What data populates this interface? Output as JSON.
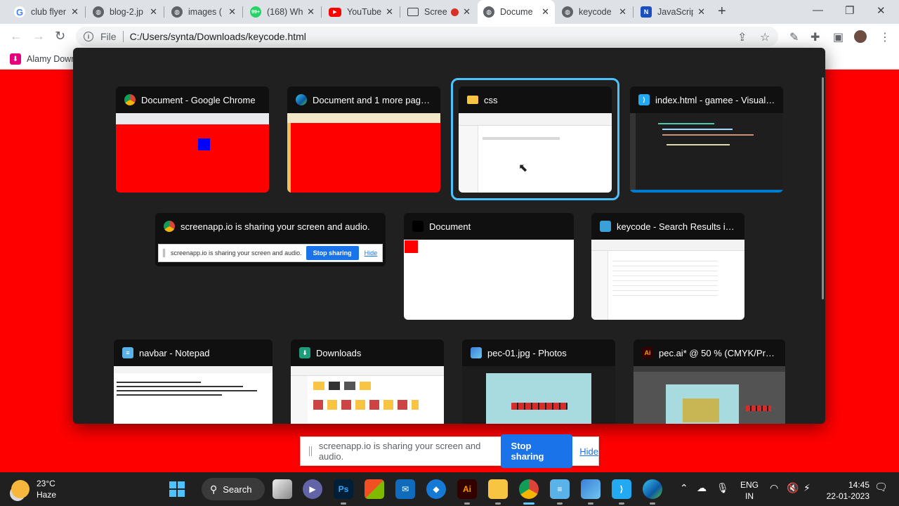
{
  "browser": {
    "tabs": [
      {
        "label": "club flyer",
        "icon": "google-icon",
        "left": 0
      },
      {
        "label": "blog-2.jp",
        "icon": "globe-icon"
      },
      {
        "label": "images (",
        "icon": "globe-icon"
      },
      {
        "label": "(168) Wh",
        "icon": "whatsapp-icon",
        "badge": "99+"
      },
      {
        "label": "YouTube",
        "icon": "youtube-icon"
      },
      {
        "label": "Scree",
        "icon": "screen-icon"
      },
      {
        "label": "Docume",
        "icon": "globe-icon",
        "active": true
      },
      {
        "label": "keycode",
        "icon": "globe-icon"
      },
      {
        "label": "JavaScrip",
        "icon": "js-icon"
      }
    ],
    "new_tab_symbol": "+",
    "address": {
      "scheme": "File",
      "url": "C:/Users/synta/Downloads/keycode.html"
    },
    "bookmark": "Alamy Down"
  },
  "switcher": {
    "windows": [
      {
        "title": "Document - Google Chrome",
        "icon": "chrome-icon"
      },
      {
        "title": "Document and 1 more page -...",
        "icon": "edge-icon"
      },
      {
        "title": "css",
        "icon": "folder-icon",
        "selected": true
      },
      {
        "title": "index.html - gamee - Visual St...",
        "icon": "vscode-icon"
      },
      {
        "title": "screenapp.io is sharing your screen and audio.",
        "icon": "chrome-icon"
      },
      {
        "title": "Document",
        "icon": "blank-icon"
      },
      {
        "title": "keycode - Search Results in D...",
        "icon": "search-results-icon"
      },
      {
        "title": "navbar - Notepad",
        "icon": "notepad-icon"
      },
      {
        "title": "Downloads",
        "icon": "downloads-folder-icon"
      },
      {
        "title": "pec-01.jpg - Photos",
        "icon": "photos-icon"
      },
      {
        "title": "pec.ai* @ 50 % (CMYK/Previe...",
        "icon": "illustrator-icon"
      }
    ],
    "mini_share": {
      "text": "screenapp.io is sharing your screen and audio.",
      "stop": "Stop sharing",
      "hide": "Hide"
    }
  },
  "sharebar": {
    "text": "screenapp.io is sharing your screen and audio.",
    "stop_label": "Stop sharing",
    "hide_label": "Hide"
  },
  "taskbar": {
    "weather": {
      "temp": "23°C",
      "condition": "Haze"
    },
    "search_label": "Search",
    "language": {
      "line1": "ENG",
      "line2": "IN"
    },
    "clock": {
      "time": "14:45",
      "date": "22-01-2023"
    }
  },
  "colors": {
    "page_bg": "#ff0000",
    "switcher_bg": "#202020",
    "selection": "#4cc2ff",
    "accent": "#1a73e8"
  }
}
